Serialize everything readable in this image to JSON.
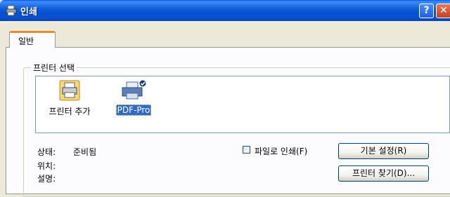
{
  "window": {
    "title": "인쇄"
  },
  "title_buttons": {
    "help": "?",
    "close": "✕"
  },
  "tabs": [
    {
      "label": "일반"
    }
  ],
  "printer_group": {
    "legend": "프린터 선택",
    "items": [
      {
        "label": "프린터 추가",
        "icon": "add-printer-icon"
      },
      {
        "label": "PDF-Pro",
        "icon": "printer-icon",
        "selected": true
      }
    ]
  },
  "status": {
    "status_label": "상태:",
    "status_value": "준비됨",
    "location_label": "위치:",
    "comment_label": "설명:"
  },
  "print_to_file": {
    "label": "파일로 인쇄(F)",
    "checked": false
  },
  "buttons": {
    "preferences": "기본 설정(R)",
    "find_printer": "프린터 찾기(D)..."
  },
  "colors": {
    "title_bar": "#0553cf",
    "selection": "#316ac5",
    "tab_accent": "#e68b2c",
    "dialog_bg": "#ece9d8"
  }
}
